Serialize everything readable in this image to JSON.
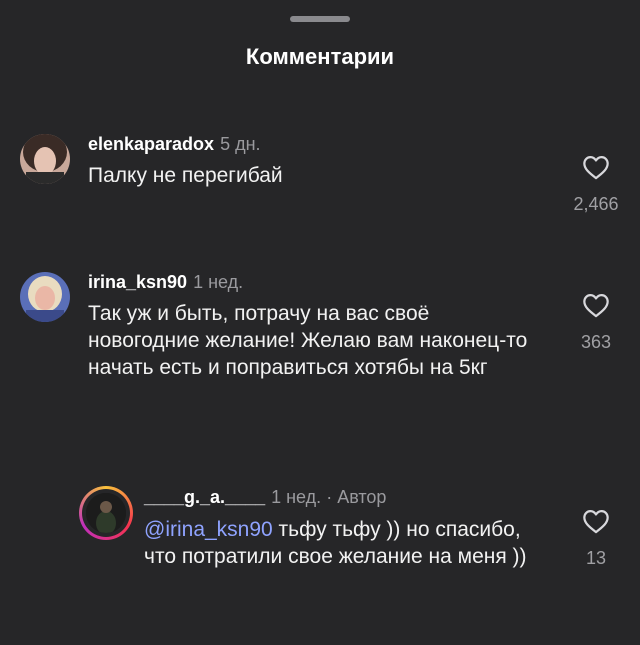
{
  "header": {
    "title": "Комментарии"
  },
  "comments": [
    {
      "username": "elenkaparadox",
      "time": "5 дн.",
      "text": "Палку не перегибай",
      "likes": "2,466"
    },
    {
      "username": "irina_ksn90",
      "time": "1 нед.",
      "text": "Так уж и быть, потрачу на вас своё новогодние желание! Желаю вам наконец-то начать есть и поправиться хотябы на 5кг",
      "likes": "363"
    }
  ],
  "reply": {
    "username": "____g._a.____",
    "time": "1 нед.",
    "author_label": "· Автор",
    "mention": "@irina_ksn90",
    "text": " тьфу тьфу )) но спасибо, что потратили свое желание на меня ))",
    "likes": "13"
  },
  "icons": {
    "like": "heart-outline-icon"
  },
  "colors": {
    "background": "#262628",
    "mention": "#8fa3ff"
  }
}
